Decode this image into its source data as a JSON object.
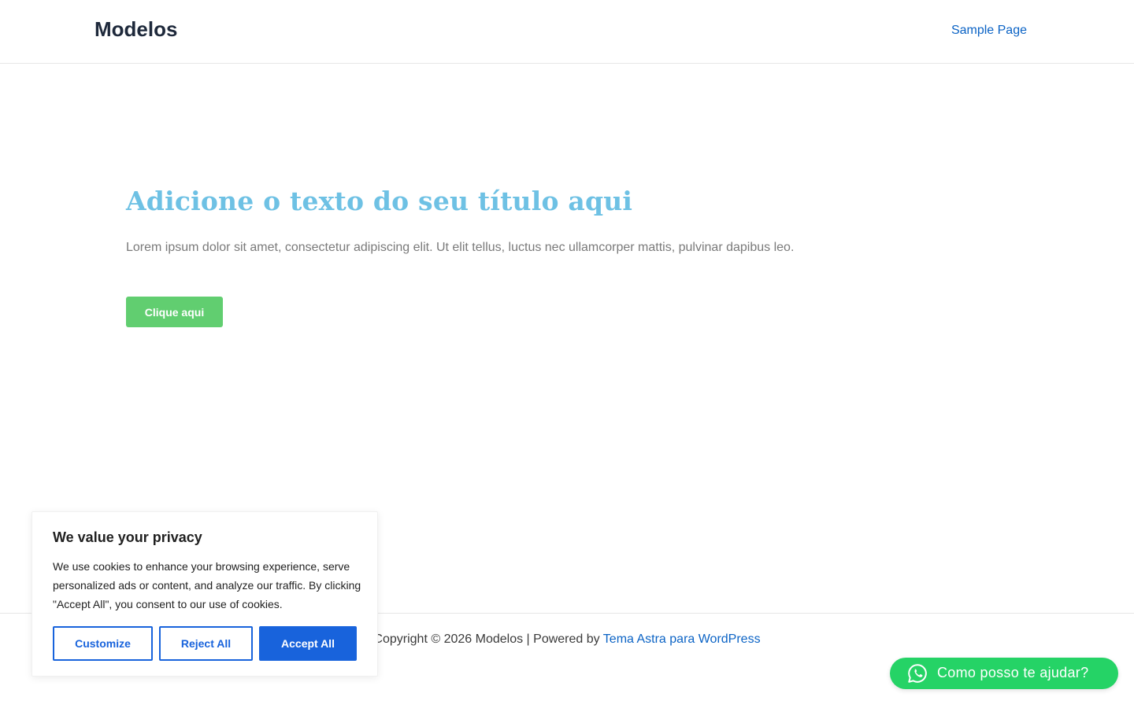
{
  "header": {
    "site_title": "Modelos",
    "nav": [
      {
        "label": "Sample Page"
      }
    ]
  },
  "hero": {
    "title": "Adicione o texto do seu título aqui",
    "text": "Lorem ipsum dolor sit amet, consectetur adipiscing elit. Ut elit tellus, luctus nec ullamcorper mattis, pulvinar dapibus leo.",
    "button_label": "Clique aqui"
  },
  "footer": {
    "copyright": "Copyright © 2026 Modelos | Powered by ",
    "link_label": "Tema Astra para WordPress"
  },
  "cookie_banner": {
    "title": "We value your privacy",
    "description": "We use cookies to enhance your browsing experience, serve personalized ads or content, and analyze our traffic. By clicking \"Accept All\", you consent to our use of cookies.",
    "customize_label": "Customize",
    "reject_label": "Reject All",
    "accept_label": "Accept All"
  },
  "whatsapp": {
    "label": "Como posso te ajudar?",
    "icon": "whatsapp-icon"
  },
  "colors": {
    "accent_blue": "#1863dc",
    "link_blue": "#0b63c5",
    "hero_title": "#6ec1e4",
    "hero_button": "#61ce70",
    "whatsapp_green": "#25d366"
  }
}
